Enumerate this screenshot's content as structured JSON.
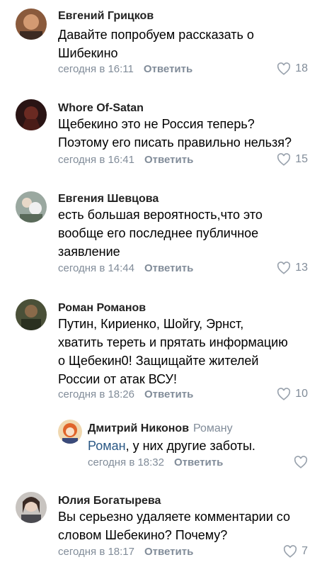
{
  "comments": [
    {
      "author": "Евгений Грицков",
      "text_lines": [
        "Давайте попробуем рассказать о",
        "Шибекино"
      ],
      "time": "сегодня в 16:11",
      "reply_label": "Ответить",
      "likes": "18"
    },
    {
      "author": "Whore Of-Satan",
      "text_lines": [
        "Щебекино  это не Россия теперь?",
        "Поэтому его писать правильно нельзя?"
      ],
      "time": "сегодня в 16:41",
      "reply_label": "Ответить",
      "likes": "15"
    },
    {
      "author": "Евгения Шевцова",
      "text_lines": [
        "есть большая вероятность,что это",
        "вообще его последнее публичное",
        "заявление"
      ],
      "time": "сегодня в 14:44",
      "reply_label": "Ответить",
      "likes": "13"
    },
    {
      "author": "Роман Романов",
      "text_lines": [
        "Путин, Кириенко, Шойгу, Эрнст,",
        "хватить тереть и прятать информацию",
        "о Щебекин0! Защищайте жителей",
        "России от атак ВСУ!"
      ],
      "time": "сегодня в 18:26",
      "reply_label": "Ответить",
      "likes": "10"
    },
    {
      "author": "Дмитрий Никонов",
      "reply_to": "Роману",
      "mention": "Роман",
      "text_rest": ", у них другие заботы.",
      "time": "сегодня в 18:32",
      "reply_label": "Ответить"
    },
    {
      "author": "Юлия Богатырева",
      "text_lines": [
        "Вы серьезно удаляете комментарии со",
        "словом Шебекино? Почему?"
      ],
      "time": "сегодня в 18:17",
      "reply_label": "Ответить",
      "likes": "7"
    }
  ]
}
